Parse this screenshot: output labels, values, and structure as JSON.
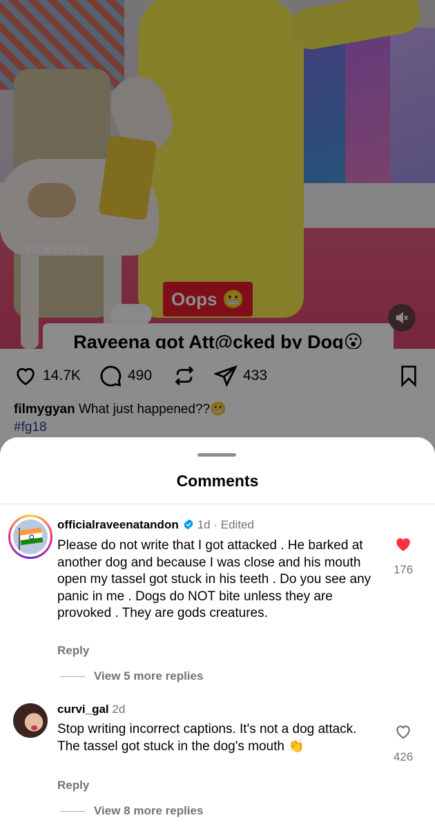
{
  "post": {
    "watermark": "FILMYGYAN",
    "sticker_text": "Oops 😬",
    "video_caption": "Raveena got Att@cked by Dog😮",
    "likes": "14.7K",
    "comments": "490",
    "shares": "433",
    "caption_user": "filmygyan",
    "caption_text": "What just happened??😬",
    "hashtag": "#fg18",
    "icons": [
      "heart-icon",
      "comment-icon",
      "repost-icon",
      "share-icon",
      "bookmark-icon",
      "mute-icon"
    ]
  },
  "comments_sheet": {
    "title": "Comments",
    "comments": [
      {
        "username": "officialraveenatandon",
        "verified": true,
        "time": "1d",
        "edited": "Edited",
        "text": "Please do not write that I got attacked . He barked at another dog and because I was close and his mouth open my tassel got stuck in his teeth . Do you see any panic in me . Dogs do NOT bite unless they are provoked . They are gods creatures.",
        "reply_label": "Reply",
        "more_replies": "View 5 more replies",
        "like_count": "176",
        "liked": true
      },
      {
        "username": "curvi_gal",
        "verified": false,
        "time": "2d",
        "text": "Stop writing incorrect captions. It's not a dog attack. The tassel got stuck in the dog's mouth 👏",
        "reply_label": "Reply",
        "more_replies": "View 8 more replies",
        "like_count": "426",
        "liked": false
      }
    ]
  },
  "colors": {
    "like_red": "#ff3040",
    "verified_blue": "#0095f6",
    "sticker_red": "#e51b2a"
  }
}
